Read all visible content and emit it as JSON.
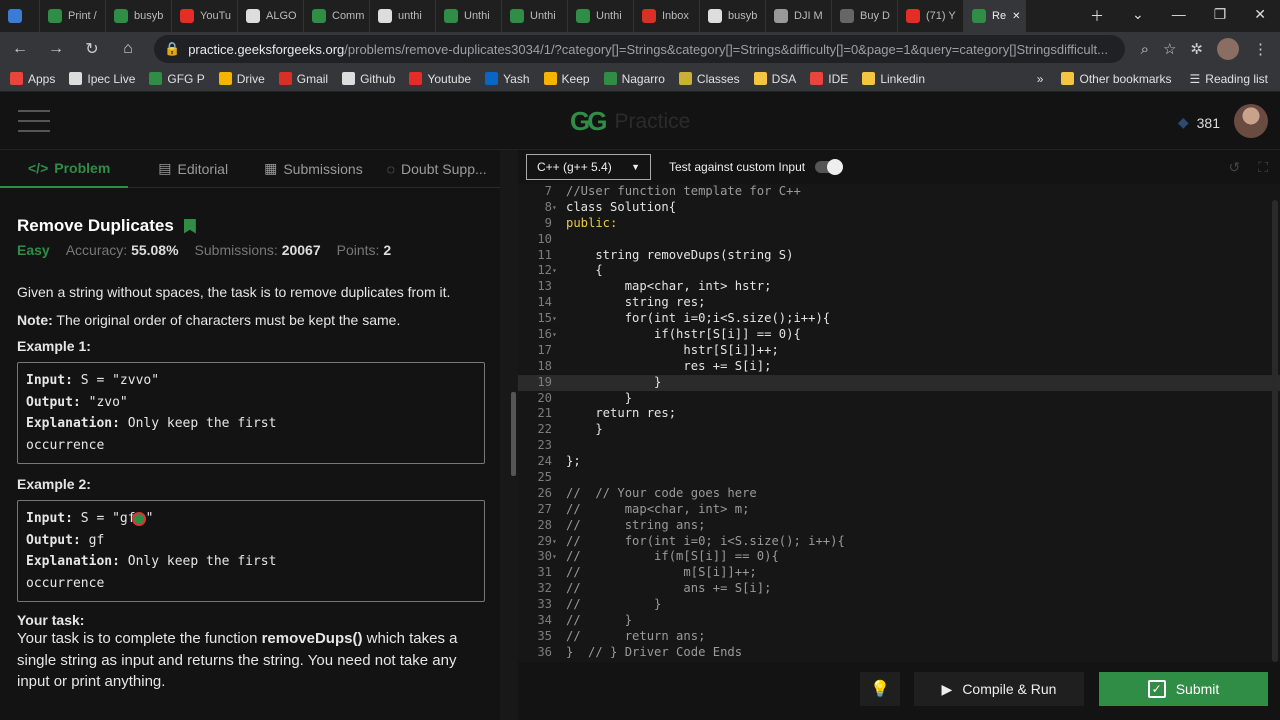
{
  "browser": {
    "tabs": [
      {
        "label": "",
        "fav": "#3a7bd5"
      },
      {
        "label": "Print /",
        "fav": "#2f8d46"
      },
      {
        "label": "busyb",
        "fav": "#2f8d46"
      },
      {
        "label": "YouTu",
        "fav": "#e52d27"
      },
      {
        "label": "ALGO",
        "fav": "#dddddd"
      },
      {
        "label": "Comm",
        "fav": "#2f8d46"
      },
      {
        "label": "unthi",
        "fav": "#dddddd"
      },
      {
        "label": "Unthi",
        "fav": "#2f8d46"
      },
      {
        "label": "Unthi",
        "fav": "#2f8d46"
      },
      {
        "label": "Unthi",
        "fav": "#2f8d46"
      },
      {
        "label": "Inbox",
        "fav": "#d93025"
      },
      {
        "label": "busyb",
        "fav": "#dddddd"
      },
      {
        "label": "DJI M",
        "fav": "#999999"
      },
      {
        "label": "Buy D",
        "fav": "#666666"
      },
      {
        "label": "(71) Y",
        "fav": "#e52d27"
      },
      {
        "label": "Re",
        "fav": "#2f8d46"
      }
    ],
    "active_tab_index": 15,
    "url_host": "practice.geeksforgeeks.org",
    "url_rest": "/problems/remove-duplicates3034/1/?category[]=Strings&category[]=Strings&difficulty[]=0&page=1&query=category[]Stringsdifficult...",
    "bookmarks": [
      {
        "label": "Apps",
        "color": "#e8453c"
      },
      {
        "label": "Ipec Live",
        "color": "#dddddd"
      },
      {
        "label": "GFG P",
        "color": "#2f8d46"
      },
      {
        "label": "Drive",
        "color": "#f4b400"
      },
      {
        "label": "Gmail",
        "color": "#d93025"
      },
      {
        "label": "Github",
        "color": "#dddddd"
      },
      {
        "label": "Youtube",
        "color": "#e52d27"
      },
      {
        "label": "Yash",
        "color": "#0a66c2"
      },
      {
        "label": "Keep",
        "color": "#f4b400"
      },
      {
        "label": "Nagarro",
        "color": "#2f8d46"
      },
      {
        "label": "Classes",
        "color": "#c9b037"
      },
      {
        "label": "DSA",
        "color": "#f4c542"
      },
      {
        "label": "IDE",
        "color": "#e8453c"
      },
      {
        "label": "Linkedin",
        "color": "#f4c542"
      }
    ],
    "bookmarks_right": [
      "Other bookmarks",
      "Reading list"
    ],
    "bookmarks_overflow": "»"
  },
  "header": {
    "logo_mark": "GG",
    "logo_word": "Practice",
    "score": "381"
  },
  "problem_tabs": [
    {
      "label": "Problem",
      "icon": "</>"
    },
    {
      "label": "Editorial",
      "icon": "▤"
    },
    {
      "label": "Submissions",
      "icon": "▦"
    },
    {
      "label": "Doubt Supp...",
      "icon": "◌"
    }
  ],
  "problem": {
    "title": "Remove Duplicates",
    "difficulty": "Easy",
    "accuracy_label": "Accuracy:",
    "accuracy": "55.08%",
    "submissions_label": "Submissions:",
    "submissions": "20067",
    "points_label": "Points:",
    "points": "2",
    "description": "Given a string without spaces, the task is to remove duplicates from it.",
    "note_label": "Note:",
    "note": " The original order of characters must be kept the same.",
    "example1_title": "Example 1:",
    "example1": {
      "input_label": "Input:",
      "input": " S = \"zvvo\"",
      "output_label": "Output:",
      "output": " \"zvo\"",
      "explanation_label": "Explanation:",
      "explanation": " Only keep the first",
      "explanation2": "occurrence"
    },
    "example2_title": "Example 2:",
    "example2": {
      "input_label": "Input:",
      "input": " S = \"gf",
      "input_tail": "\"",
      "output_label": "Output:",
      "output": " gf",
      "explanation_label": "Explanation:",
      "explanation": " Only keep the first",
      "explanation2": "occurrence"
    },
    "task_title": "Your task:",
    "task_a": "Your task is to complete the function ",
    "task_fn": "removeDups()",
    "task_b": " which takes a single string as input and returns the string. You need not take any input or print anything."
  },
  "editor": {
    "language": "C++ (g++ 5.4)",
    "custom_input_label": "Test against custom Input",
    "lines": [
      {
        "n": "7",
        "code": "//User function template for C++",
        "color": "#9a9a9a"
      },
      {
        "n": "8",
        "code": "class Solution{",
        "fold": true
      },
      {
        "n": "9",
        "code": "public:",
        "color": "#e8c84a"
      },
      {
        "n": "10",
        "code": ""
      },
      {
        "n": "11",
        "code": "    string removeDups(string S)"
      },
      {
        "n": "12",
        "code": "    {",
        "fold": true
      },
      {
        "n": "13",
        "code": "        map<char, int> hstr;"
      },
      {
        "n": "14",
        "code": "        string res;"
      },
      {
        "n": "15",
        "code": "        for(int i=0;i<S.size();i++){",
        "fold": true
      },
      {
        "n": "16",
        "code": "            if(hstr[S[i]] == 0){",
        "fold": true
      },
      {
        "n": "17",
        "code": "                hstr[S[i]]++;"
      },
      {
        "n": "18",
        "code": "                res += S[i];"
      },
      {
        "n": "19",
        "code": "            }",
        "hl": true
      },
      {
        "n": "20",
        "code": "        }"
      },
      {
        "n": "21",
        "code": "    return res;"
      },
      {
        "n": "22",
        "code": "    }"
      },
      {
        "n": "23",
        "code": ""
      },
      {
        "n": "24",
        "code": "};"
      },
      {
        "n": "25",
        "code": ""
      },
      {
        "n": "26",
        "code": "//  // Your code goes here",
        "color": "#9a9a9a"
      },
      {
        "n": "27",
        "code": "//      map<char, int> m;",
        "color": "#9a9a9a"
      },
      {
        "n": "28",
        "code": "//      string ans;",
        "color": "#9a9a9a"
      },
      {
        "n": "29",
        "code": "//      for(int i=0; i<S.size(); i++){",
        "color": "#9a9a9a",
        "fold": true
      },
      {
        "n": "30",
        "code": "//          if(m[S[i]] == 0){",
        "color": "#9a9a9a",
        "fold": true
      },
      {
        "n": "31",
        "code": "//              m[S[i]]++;",
        "color": "#9a9a9a"
      },
      {
        "n": "32",
        "code": "//              ans += S[i];",
        "color": "#9a9a9a"
      },
      {
        "n": "33",
        "code": "//          }",
        "color": "#9a9a9a"
      },
      {
        "n": "34",
        "code": "//      }",
        "color": "#9a9a9a"
      },
      {
        "n": "35",
        "code": "//      return ans;",
        "color": "#9a9a9a"
      },
      {
        "n": "36",
        "code": "}  // } Driver Code Ends",
        "color": "#9a9a9a"
      }
    ],
    "compile_label": "Compile & Run",
    "submit_label": "Submit"
  },
  "colors": {
    "brand": "#2f8d46",
    "bg": "#131313"
  }
}
